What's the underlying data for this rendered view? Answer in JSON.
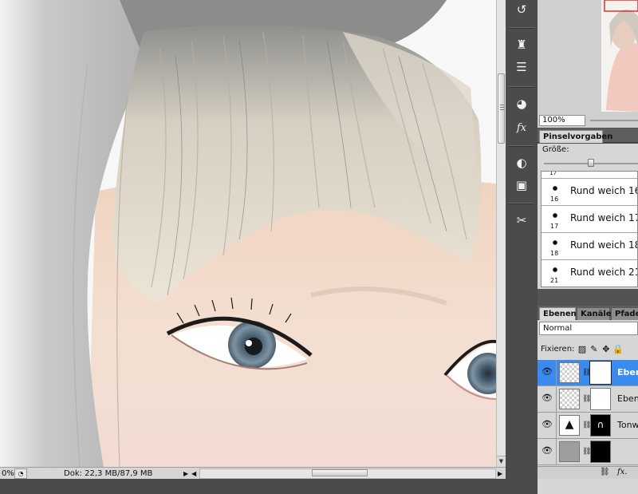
{
  "statusbar": {
    "zoom": "0%",
    "doc_info": "Dok: 22,3 MB/87,9 MB"
  },
  "navigator": {
    "zoom_value": "100%"
  },
  "brush_panel": {
    "tab_label": "Pinselvorgaben",
    "size_label": "Größe:",
    "size_slider_fraction": 0.5,
    "partial_size": "17",
    "brushes": [
      {
        "size": "16",
        "name": "Rund weich 16"
      },
      {
        "size": "17",
        "name": "Rund weich 17"
      },
      {
        "size": "18",
        "name": "Rund weich 18"
      },
      {
        "size": "21",
        "name": "Rund weich 21"
      }
    ]
  },
  "layers_panel": {
    "tabs": [
      "Ebenen",
      "Kanäle",
      "Pfade"
    ],
    "blend_mode": "Normal",
    "lock_label": "Fixieren:",
    "layers": [
      {
        "name": "Ebene",
        "selected": true,
        "thumb": "transparent"
      },
      {
        "name": "Ebene",
        "selected": false,
        "thumb": "transparent"
      },
      {
        "name": "Tonw",
        "selected": false,
        "thumb": "levels"
      },
      {
        "name": "",
        "selected": false,
        "thumb": "gray"
      }
    ],
    "footer_fx": "fx."
  },
  "toolstrip": {
    "icons": [
      "history-icon",
      "clone-source-icon",
      "tool-presets-icon",
      "color-swatches-icon",
      "styles-fx-icon",
      "adjustments-icon",
      "masks-icon",
      "brush-settings-icon"
    ]
  },
  "colors": {
    "workspace": "#4a4a4a",
    "panel": "#d6d6d6",
    "selection": "#3a8bf0"
  }
}
